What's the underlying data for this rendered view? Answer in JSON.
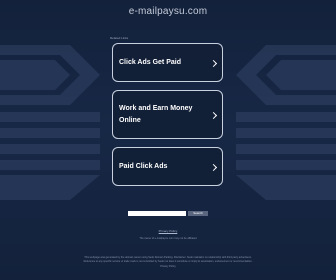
{
  "page": {
    "domain": "e-mailpaysu.com",
    "related_label": "Related Links",
    "links": [
      {
        "label": "Click Ads Get Paid"
      },
      {
        "label": "Work and Earn Money Online"
      },
      {
        "label": "Paid Click Ads"
      }
    ],
    "search": {
      "placeholder": "",
      "button_label": "Search"
    },
    "privacy_label": "Privacy Policy",
    "owner_line": "The owner of e-mailpaysu.com may not be affiliated",
    "disclaimer_1": "This webpage was generated by the domain owner using Sedo Domain Parking. Disclaimer: Sedo maintains no relationship with third party advertisers.",
    "disclaimer_2": "Reference to any specific service or trade mark is not controlled by Sedo nor does it constitute or imply its association, endorsement or recommendation.",
    "footer_mark": "Privacy Policy"
  },
  "colors": {
    "background": "#13213b",
    "stripe": "#2a3b5c",
    "card_border": "#c9d1e0",
    "text": "#ffffff"
  }
}
